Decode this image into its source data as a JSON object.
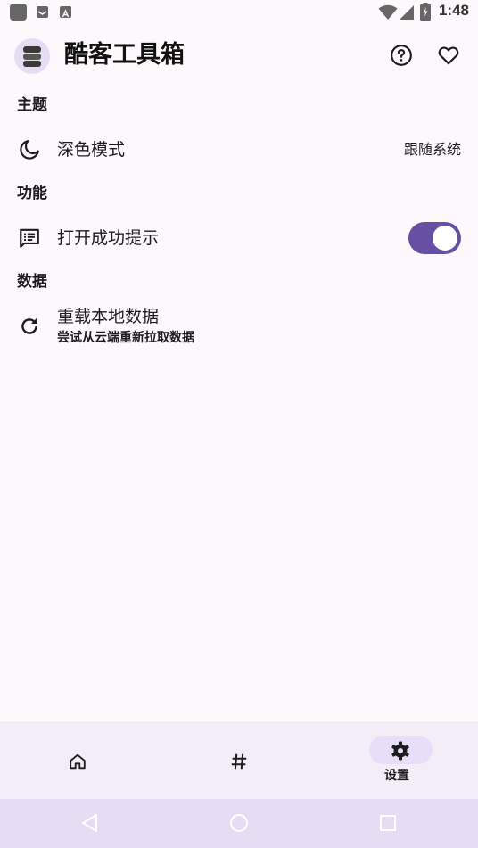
{
  "status_bar": {
    "time": "1:48",
    "icons": [
      "app-icon",
      "mail-icon",
      "text-a-icon",
      "wifi-icon",
      "signal-icon",
      "battery-charging-icon"
    ]
  },
  "app_bar": {
    "title": "酷客工具箱",
    "logo_icon": "stack-layers-icon",
    "actions": [
      "help-icon",
      "favorite-heart-icon"
    ]
  },
  "sections": {
    "theme": {
      "header": "主题",
      "dark_mode": {
        "icon": "moon-icon",
        "title": "深色模式",
        "value": "跟随系统"
      }
    },
    "features": {
      "header": "功能",
      "success_tip": {
        "icon": "message-list-icon",
        "title": "打开成功提示",
        "enabled": true
      }
    },
    "data": {
      "header": "数据",
      "reload": {
        "icon": "refresh-icon",
        "title": "重载本地数据",
        "subtitle": "尝试从云端重新拉取数据"
      }
    }
  },
  "bottom_nav": {
    "items": [
      {
        "icon": "home-icon",
        "label": "",
        "selected": false
      },
      {
        "icon": "hashtag-icon",
        "label": "",
        "selected": false
      },
      {
        "icon": "settings-gear-icon",
        "label": "设置",
        "selected": true
      }
    ]
  },
  "system_nav": [
    "back-triangle-icon",
    "home-circle-icon",
    "recents-square-icon"
  ],
  "colors": {
    "background": "#fdf8fc",
    "accent": "#6750a4",
    "nav_background": "#f3edf7",
    "nav_indicator": "#e8def8",
    "system_nav": "#e6dcf4"
  }
}
